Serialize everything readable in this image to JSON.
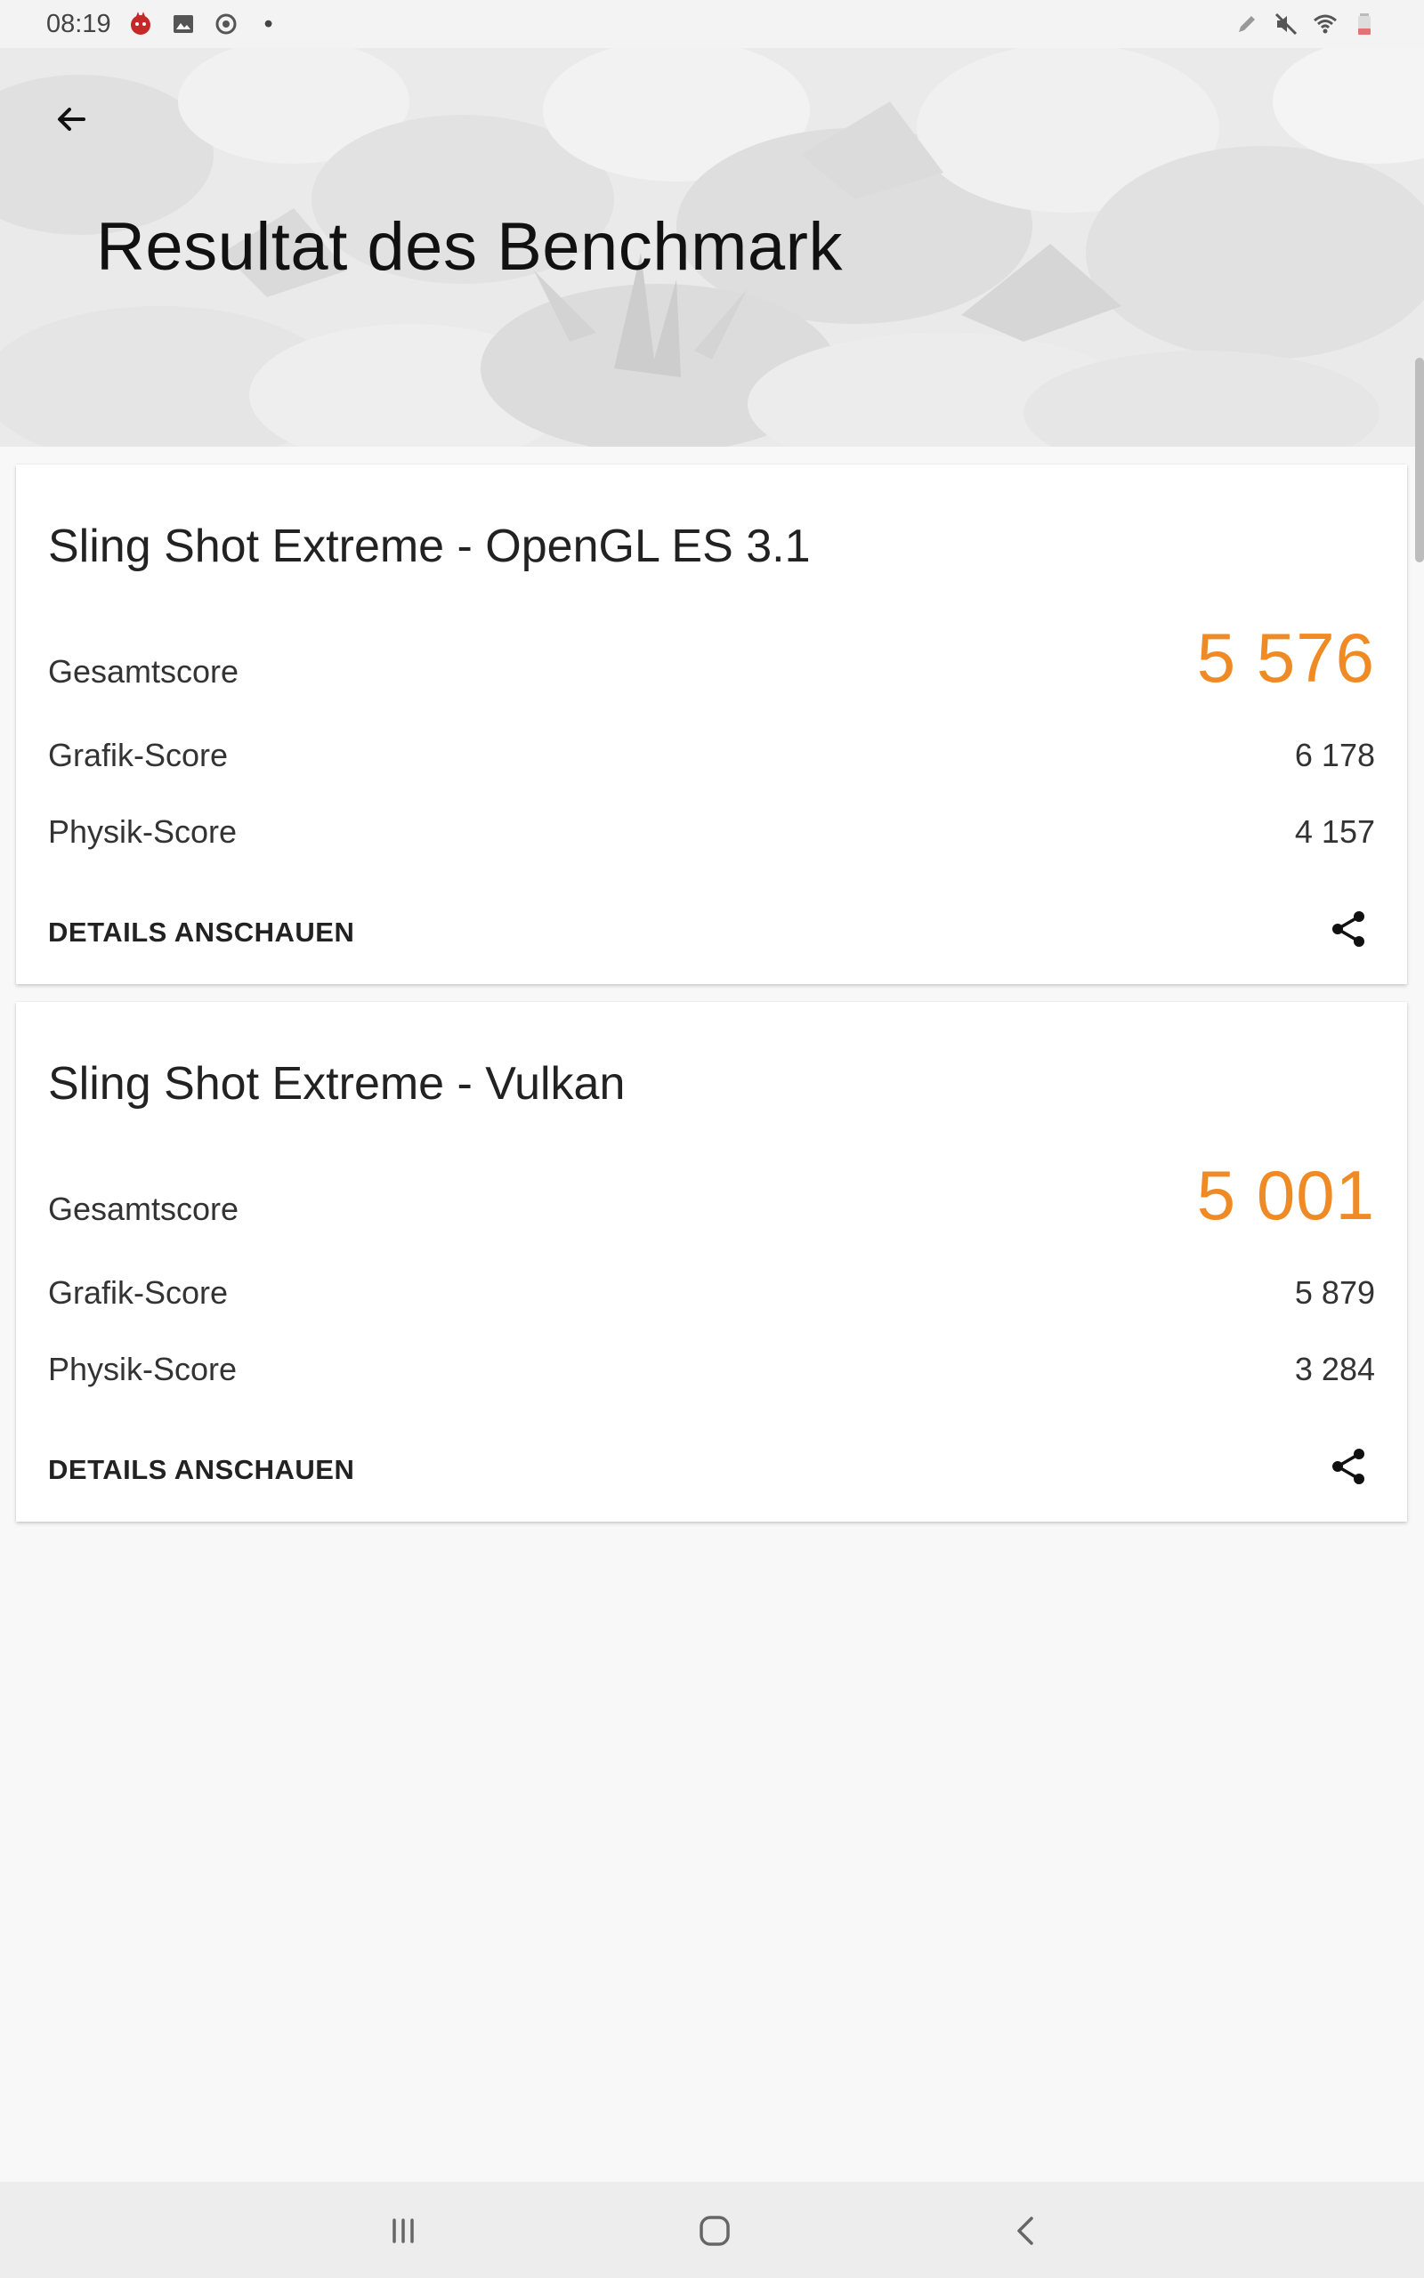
{
  "status_bar": {
    "time": "08:19",
    "left_icons": [
      "app-notification-icon",
      "gallery-icon",
      "sync-icon",
      "more-dot-icon"
    ],
    "right_icons": [
      "pen-icon",
      "mute-icon",
      "wifi-icon",
      "battery-icon"
    ],
    "more_dot": "•"
  },
  "header": {
    "title": "Resultat des Benchmark",
    "back_icon": "arrow-back-icon"
  },
  "results": [
    {
      "title": "Sling Shot Extreme - OpenGL ES 3.1",
      "total_label": "Gesamtscore",
      "total_value": "5 576",
      "graphics_label": "Grafik-Score",
      "graphics_value": "6 178",
      "physics_label": "Physik-Score",
      "physics_value": "4 157",
      "details_label": "DETAILS ANSCHAUEN",
      "share_icon": "share-icon"
    },
    {
      "title": "Sling Shot Extreme - Vulkan",
      "total_label": "Gesamtscore",
      "total_value": "5 001",
      "graphics_label": "Grafik-Score",
      "graphics_value": "5 879",
      "physics_label": "Physik-Score",
      "physics_value": "3 284",
      "details_label": "DETAILS ANSCHAUEN",
      "share_icon": "share-icon"
    }
  ],
  "nav_bar": {
    "buttons": [
      "recents-icon",
      "home-icon",
      "back-icon"
    ]
  },
  "colors": {
    "accent": "#f08a24",
    "background": "#f8f8f8",
    "card": "#ffffff"
  }
}
